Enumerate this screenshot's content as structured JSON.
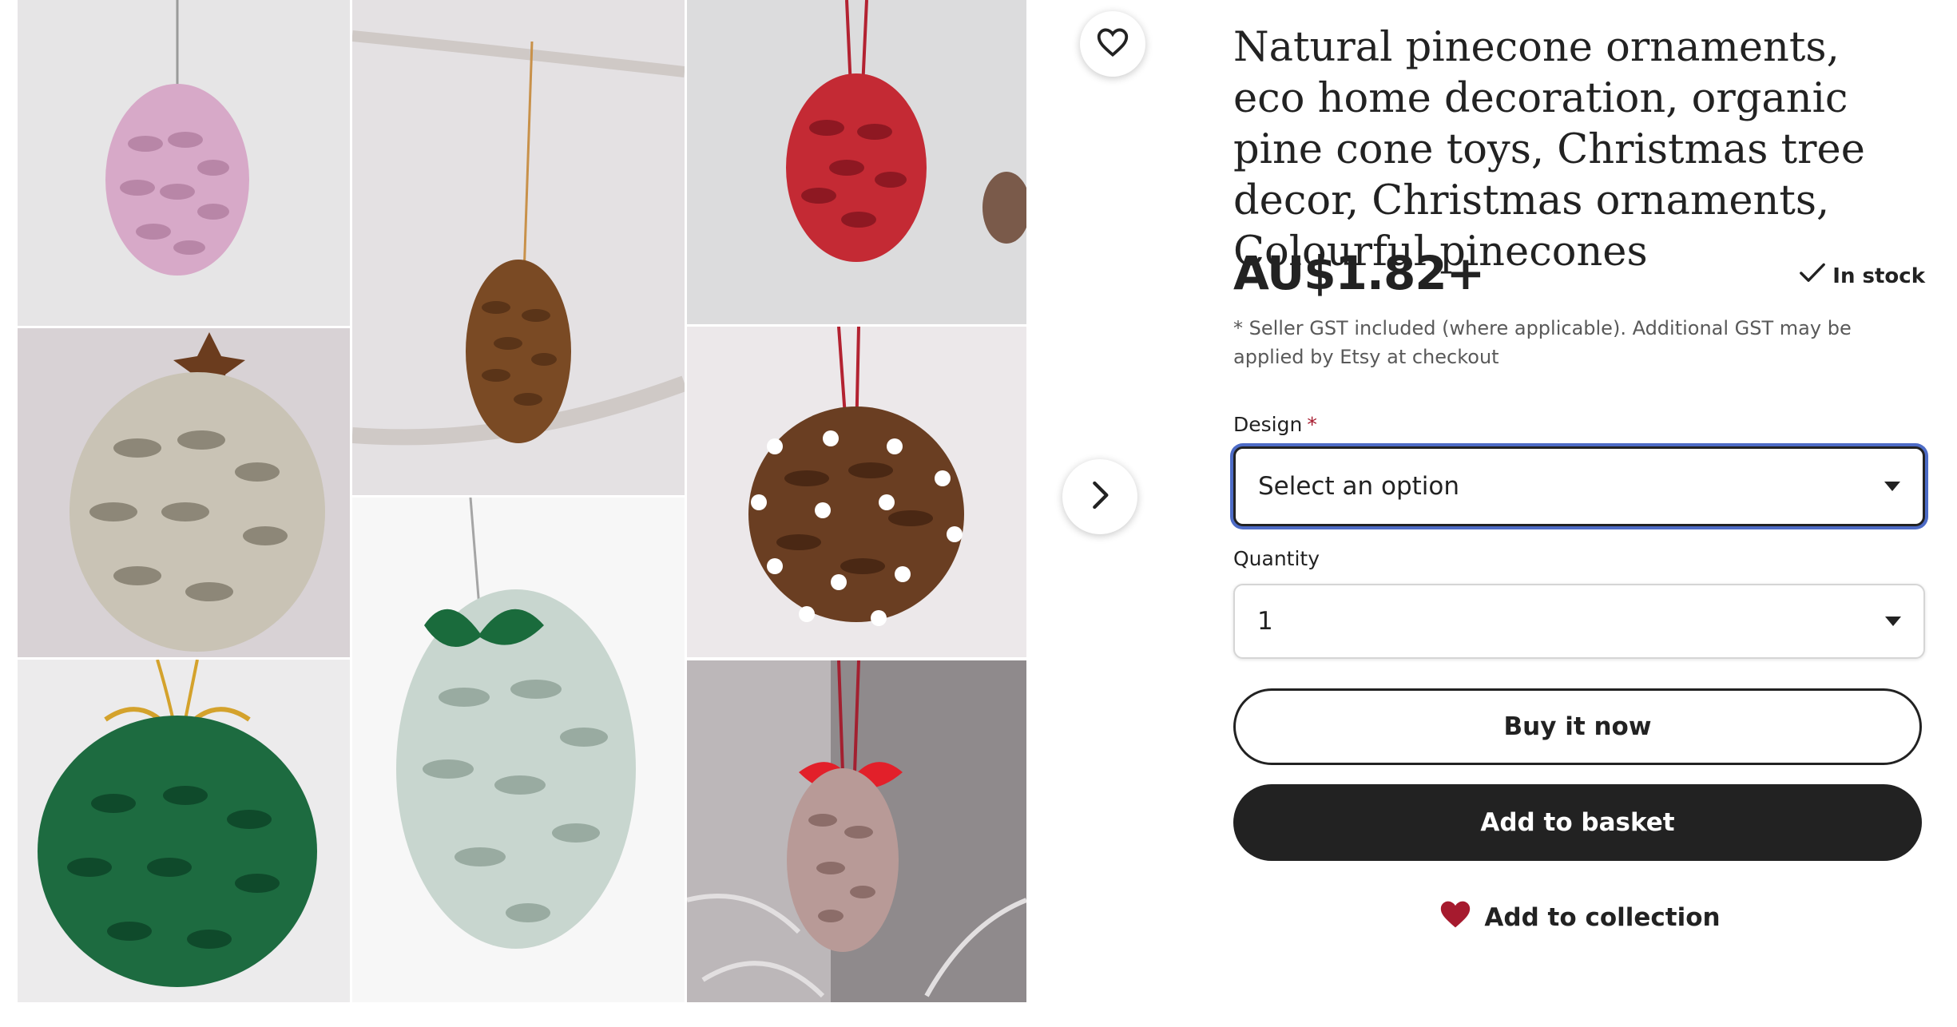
{
  "gallery": {
    "favorite_icon": "heart-outline-icon",
    "next_icon": "chevron-right-icon",
    "tiles": [
      {
        "name": "pink-pinecone",
        "color": "#d7a9c8"
      },
      {
        "name": "natural-pinecone",
        "color": "#7a4a24"
      },
      {
        "name": "red-pinecone",
        "color": "#c42a34"
      },
      {
        "name": "frosted-star-anise-pinecone",
        "color": "#c9c3b5"
      },
      {
        "name": "polka-dot-pinecone",
        "color": "#6a3e22"
      },
      {
        "name": "white-green-bow-pinecone",
        "color": "#c8d6cf"
      },
      {
        "name": "green-gold-bow-pinecone",
        "color": "#1d6b40"
      },
      {
        "name": "red-bow-glitter-pinecone",
        "color": "#b89a97"
      }
    ]
  },
  "product": {
    "title": "Natural pinecone ornaments, eco home decoration, organic pine cone toys, Christmas tree decor, Christmas ornaments, Colourful pinecones",
    "price": "AU$1.82+",
    "stock_status": "In stock",
    "stock_icon": "checkmark-icon",
    "gst_note": "* Seller GST included (where applicable). Additional GST may be applied by Etsy at checkout"
  },
  "design": {
    "label": "Design",
    "required_marker": "*",
    "selected": "Select an option"
  },
  "quantity": {
    "label": "Quantity",
    "selected": "1"
  },
  "actions": {
    "buy_now": "Buy it now",
    "add_to_basket": "Add to basket",
    "add_to_collection": "Add to collection",
    "collection_icon": "heart-filled-icon"
  },
  "colors": {
    "text": "#222222",
    "required": "#a61a2e",
    "focus_ring": "#4d6bc6",
    "collection_heart": "#a61a2e",
    "primary_button": "#222222"
  }
}
